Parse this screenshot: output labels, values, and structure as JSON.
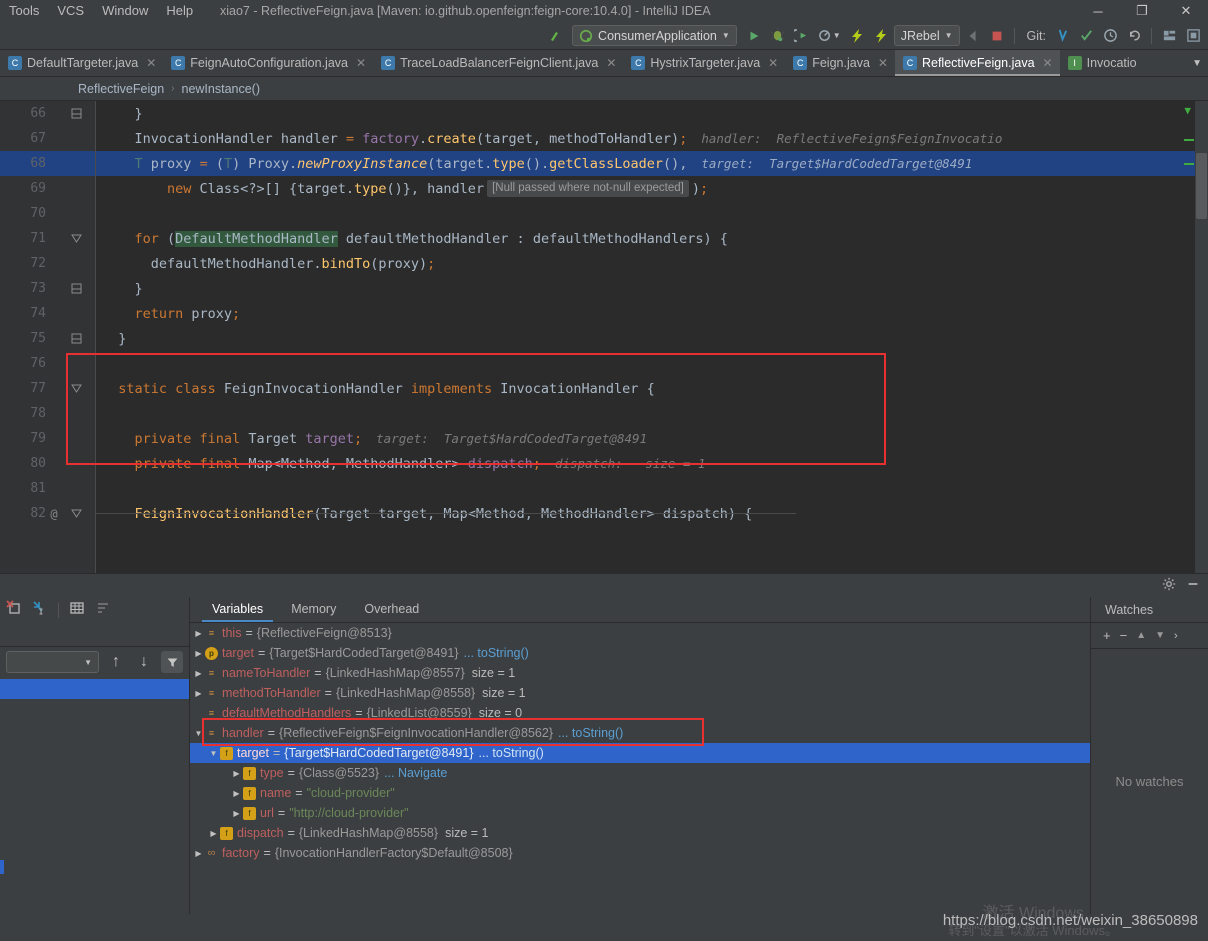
{
  "window": {
    "title": "xiao7 - ReflectiveFeign.java [Maven: io.github.openfeign:feign-core:10.4.0] - IntelliJ IDEA",
    "minimize": "─",
    "maximize": "❐",
    "close": "✕"
  },
  "menu": {
    "items": [
      {
        "label": "Tools"
      },
      {
        "label": "VCS"
      },
      {
        "label": "Window"
      },
      {
        "label": "Help"
      }
    ]
  },
  "toolbar": {
    "update_icon": "update-arrow-icon",
    "run_config": "ConsumerApplication",
    "run": "run-icon",
    "debug": "debug-icon",
    "run_coverage": "run-with-coverage-icon",
    "profile": "profile-icon",
    "jrebel_run": "jrebel-run-icon",
    "jrebel_debug": "jrebel-debug-icon",
    "jrebel_label": "JRebel",
    "stop": "stop-icon",
    "git_label": "Git:",
    "git_update": "git-update-icon",
    "git_commit": "git-commit-icon",
    "git_history": "git-history-icon",
    "git_revert": "git-revert-icon",
    "layout": "layout-icon",
    "search_everywhere": "search-everywhere-icon"
  },
  "tabs": [
    {
      "label": "DefaultTargeter.java",
      "icon": "java-class-icon",
      "kind": "class",
      "active": false
    },
    {
      "label": "FeignAutoConfiguration.java",
      "icon": "java-class-icon",
      "kind": "class",
      "active": false
    },
    {
      "label": "TraceLoadBalancerFeignClient.java",
      "icon": "java-class-icon",
      "kind": "class",
      "active": false
    },
    {
      "label": "HystrixTargeter.java",
      "icon": "java-class-icon",
      "kind": "class",
      "active": false
    },
    {
      "label": "Feign.java",
      "icon": "java-class-icon",
      "kind": "class",
      "active": false
    },
    {
      "label": "ReflectiveFeign.java",
      "icon": "java-class-icon",
      "kind": "class",
      "active": true
    },
    {
      "label": "Invocatio",
      "icon": "java-interface-icon",
      "kind": "interface",
      "active": false
    }
  ],
  "breadcrumb": {
    "class": "ReflectiveFeign",
    "separator": "›",
    "method": "newInstance()"
  },
  "editor": {
    "warning_tooltip": "[Null passed where not-null expected]",
    "search_highlight": "DefaultMethodHandler",
    "lines": [
      {
        "num": "66",
        "fold": "end",
        "highlight": false
      },
      {
        "num": "67",
        "fold": "",
        "highlight": false,
        "hint": "handler:  ReflectiveFeign$FeignInvocatio"
      },
      {
        "num": "68",
        "fold": "",
        "highlight": true,
        "hint": "target:  Target$HardCodedTarget@8491"
      },
      {
        "num": "69",
        "fold": "",
        "highlight": false
      },
      {
        "num": "70",
        "fold": "",
        "highlight": false
      },
      {
        "num": "71",
        "fold": "start",
        "highlight": false
      },
      {
        "num": "72",
        "fold": "",
        "highlight": false
      },
      {
        "num": "73",
        "fold": "end",
        "highlight": false
      },
      {
        "num": "74",
        "fold": "",
        "highlight": false
      },
      {
        "num": "75",
        "fold": "end",
        "highlight": false
      },
      {
        "num": "76",
        "fold": "",
        "highlight": false
      },
      {
        "num": "77",
        "fold": "start",
        "highlight": false
      },
      {
        "num": "78",
        "fold": "",
        "highlight": false
      },
      {
        "num": "79",
        "fold": "",
        "highlight": false,
        "hint": "target:  Target$HardCodedTarget@8491"
      },
      {
        "num": "80",
        "fold": "",
        "highlight": false,
        "hint": "dispatch:   size = 1"
      },
      {
        "num": "81",
        "fold": "",
        "highlight": false
      },
      {
        "num": "82",
        "fold": "start",
        "highlight": false,
        "anno": "@"
      }
    ]
  },
  "debug": {
    "settings_icon": "gear-icon",
    "hide_icon": "minimize-icon",
    "toolbar": {
      "mute_breakpoints": "mute-breakpoints-icon",
      "evaluate": "evaluate-expression-icon",
      "show_values": "show-values-inline-icon",
      "sort_values": "sort-values-icon",
      "restore_layout": "restore-layout-icon"
    },
    "frames": {
      "thread_select": "",
      "up_icon": "arrow-up-icon",
      "down_icon": "arrow-down-icon",
      "filter_icon": "filter-icon"
    },
    "tabs": [
      {
        "label": "Variables",
        "active": true
      },
      {
        "label": "Memory",
        "active": false
      },
      {
        "label": "Overhead",
        "active": false
      }
    ],
    "variables": [
      {
        "indent": 0,
        "arrow": "▶",
        "icon": "local",
        "iconGlyph": "≡",
        "name": "this",
        "value": "{ReflectiveFeign@8513}",
        "size": "",
        "link": "",
        "selected": false
      },
      {
        "indent": 0,
        "arrow": "▶",
        "icon": "param",
        "iconGlyph": "p",
        "name": "target",
        "value": "{Target$HardCodedTarget@8491}",
        "size": "",
        "link": "... toString()",
        "selected": false
      },
      {
        "indent": 0,
        "arrow": "▶",
        "icon": "local",
        "iconGlyph": "≡",
        "name": "nameToHandler",
        "value": "{LinkedHashMap@8557}",
        "size": "size = 1",
        "link": "",
        "selected": false
      },
      {
        "indent": 0,
        "arrow": "▶",
        "icon": "local",
        "iconGlyph": "≡",
        "name": "methodToHandler",
        "value": "{LinkedHashMap@8558}",
        "size": "size = 1",
        "link": "",
        "selected": false
      },
      {
        "indent": 0,
        "arrow": "",
        "icon": "local",
        "iconGlyph": "≡",
        "name": "defaultMethodHandlers",
        "value": "{LinkedList@8559}",
        "size": "size = 0",
        "link": "",
        "selected": false
      },
      {
        "indent": 0,
        "arrow": "▼",
        "icon": "local",
        "iconGlyph": "≡",
        "name": "handler",
        "value": "{ReflectiveFeign$FeignInvocationHandler@8562}",
        "size": "",
        "link": "... toString()",
        "selected": false
      },
      {
        "indent": 1,
        "arrow": "▼",
        "icon": "field",
        "iconGlyph": "f",
        "name": "target",
        "value": "{Target$HardCodedTarget@8491}",
        "size": "",
        "link": "... toString()",
        "selected": true
      },
      {
        "indent": 2,
        "arrow": "▶",
        "icon": "field",
        "iconGlyph": "f",
        "name": "type",
        "value": "{Class@5523}",
        "size": "",
        "link": "... Navigate",
        "selected": false
      },
      {
        "indent": 2,
        "arrow": "▶",
        "icon": "field",
        "iconGlyph": "f",
        "name": "name",
        "value": "\"cloud-provider\"",
        "size": "",
        "link": "",
        "selected": false,
        "isString": true
      },
      {
        "indent": 2,
        "arrow": "▶",
        "icon": "field",
        "iconGlyph": "f",
        "name": "url",
        "value": "\"http://cloud-provider\"",
        "size": "",
        "link": "",
        "selected": false,
        "isString": true
      },
      {
        "indent": 1,
        "arrow": "▶",
        "icon": "field",
        "iconGlyph": "f",
        "name": "dispatch",
        "value": "{LinkedHashMap@8558}",
        "size": "size = 1",
        "link": "",
        "selected": false
      },
      {
        "indent": 0,
        "arrow": "▶",
        "icon": "statc",
        "iconGlyph": "∞",
        "name": "factory",
        "value": "{InvocationHandlerFactory$Default@8508}",
        "size": "",
        "link": "",
        "selected": false
      }
    ],
    "watches": {
      "title": "Watches",
      "add": "+",
      "remove": "−",
      "up": "▲",
      "down": "▼",
      "more": "›",
      "empty": "No watches"
    }
  },
  "watermark": {
    "url": "https://blog.csdn.net/weixin_38650898",
    "activate_line1": "激活 Windows",
    "activate_line2": "转到\"设置\"以激活 Windows。"
  },
  "colors": {
    "accent": "#2f65ca",
    "annotation_red": "#e83030",
    "keyword": "#cc7832",
    "string": "#6a8759",
    "field": "#9876aa",
    "method": "#ffc66d",
    "bg_editor": "#2b2b2b",
    "bg_chrome": "#3c3f41"
  }
}
